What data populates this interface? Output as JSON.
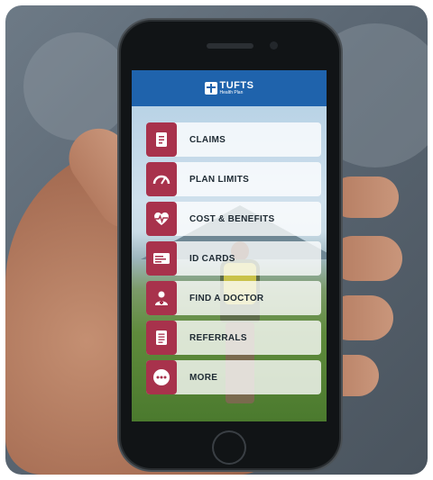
{
  "app": {
    "brand_name": "TUFTS",
    "brand_sub": "Health Plan",
    "header_color": "#1f63ac",
    "accent_color": "#a8324c"
  },
  "menu": [
    {
      "label": "CLAIMS",
      "icon": "document-icon"
    },
    {
      "label": "PLAN LIMITS",
      "icon": "gauge-icon"
    },
    {
      "label": "COST & BENEFITS",
      "icon": "heartbeat-icon"
    },
    {
      "label": "ID CARDS",
      "icon": "id-card-icon"
    },
    {
      "label": "FIND A DOCTOR",
      "icon": "doctor-icon"
    },
    {
      "label": "REFERRALS",
      "icon": "list-document-icon"
    },
    {
      "label": "MORE",
      "icon": "more-dots-icon"
    }
  ]
}
